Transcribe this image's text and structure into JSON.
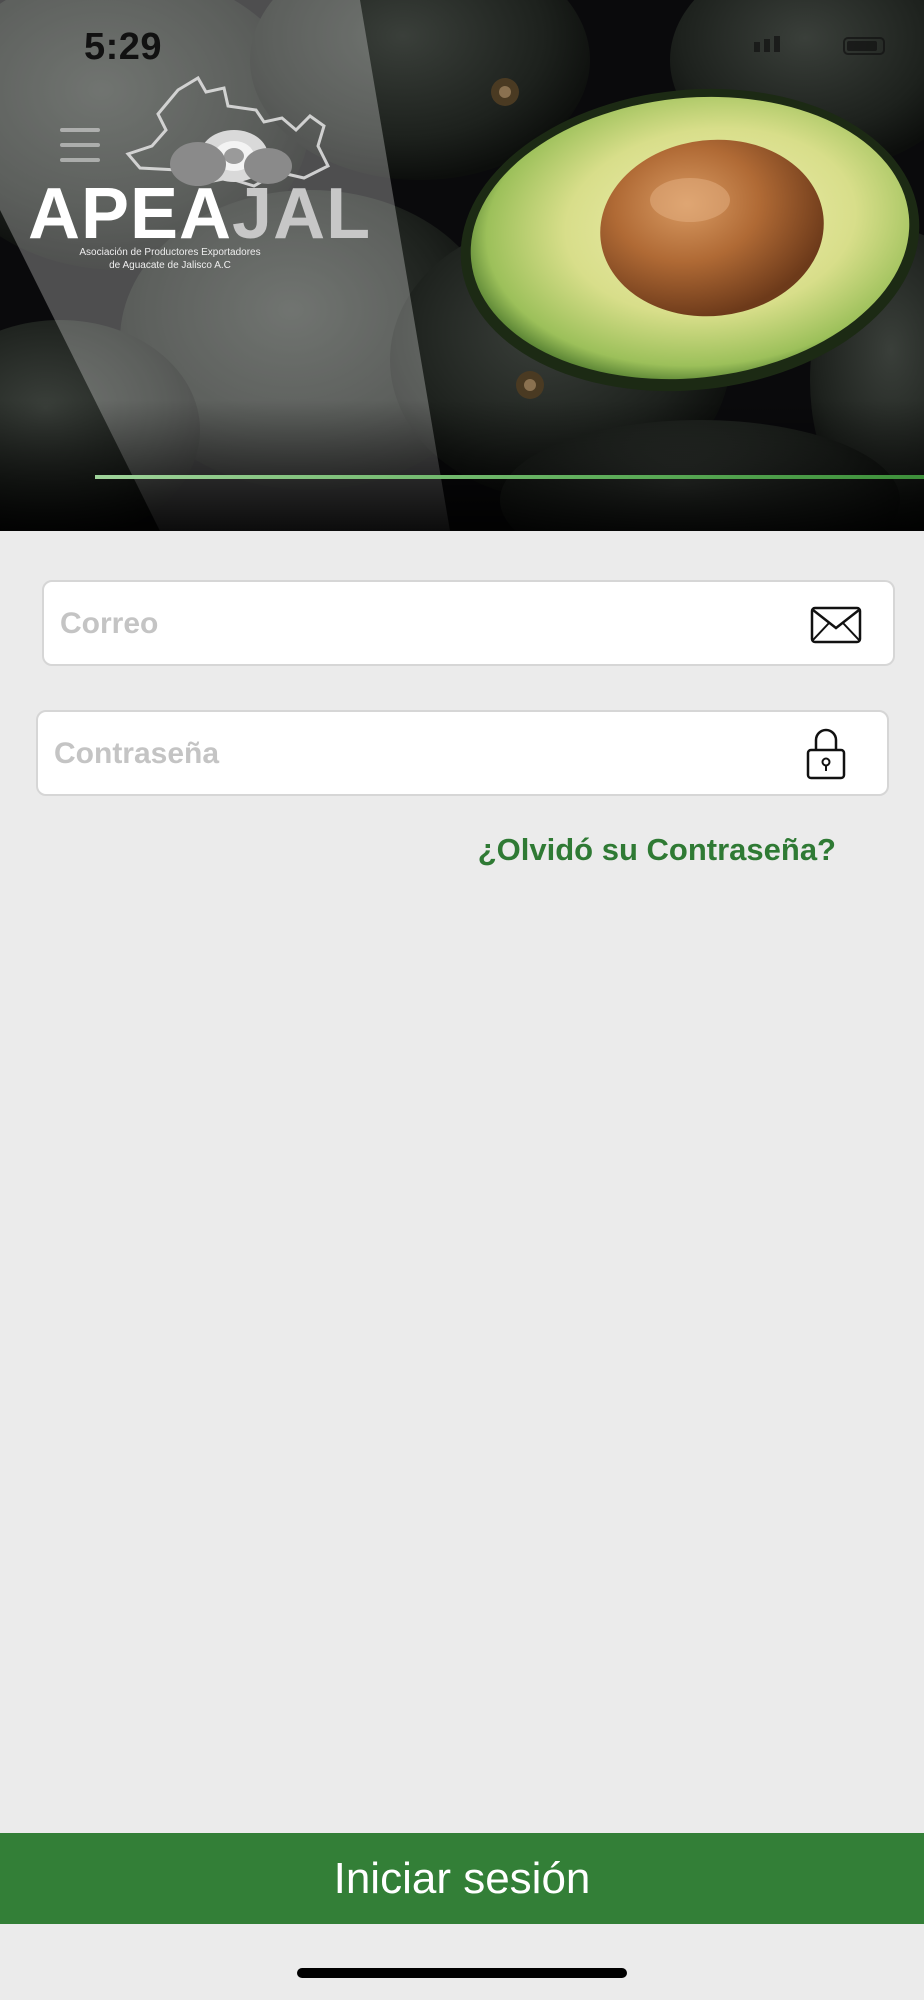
{
  "status_bar": {
    "time": "5:29"
  },
  "header": {
    "logo": {
      "word_part1": "APEA",
      "word_part2": "JAL",
      "subtitle_line1": "Asociación de Productores Exportadores",
      "subtitle_line2": "de Aguacate de Jalisco A.C"
    }
  },
  "form": {
    "email": {
      "placeholder": "Correo",
      "value": "",
      "icon": "envelope-icon"
    },
    "password": {
      "placeholder": "Contraseña",
      "value": "",
      "icon": "lock-icon"
    },
    "forgot_password_label": "¿Olvidó su Contraseña?"
  },
  "actions": {
    "login_label": "Iniciar sesión"
  },
  "colors": {
    "accent": "#337f37",
    "link": "#2f7a34",
    "background": "#ebebeb"
  }
}
